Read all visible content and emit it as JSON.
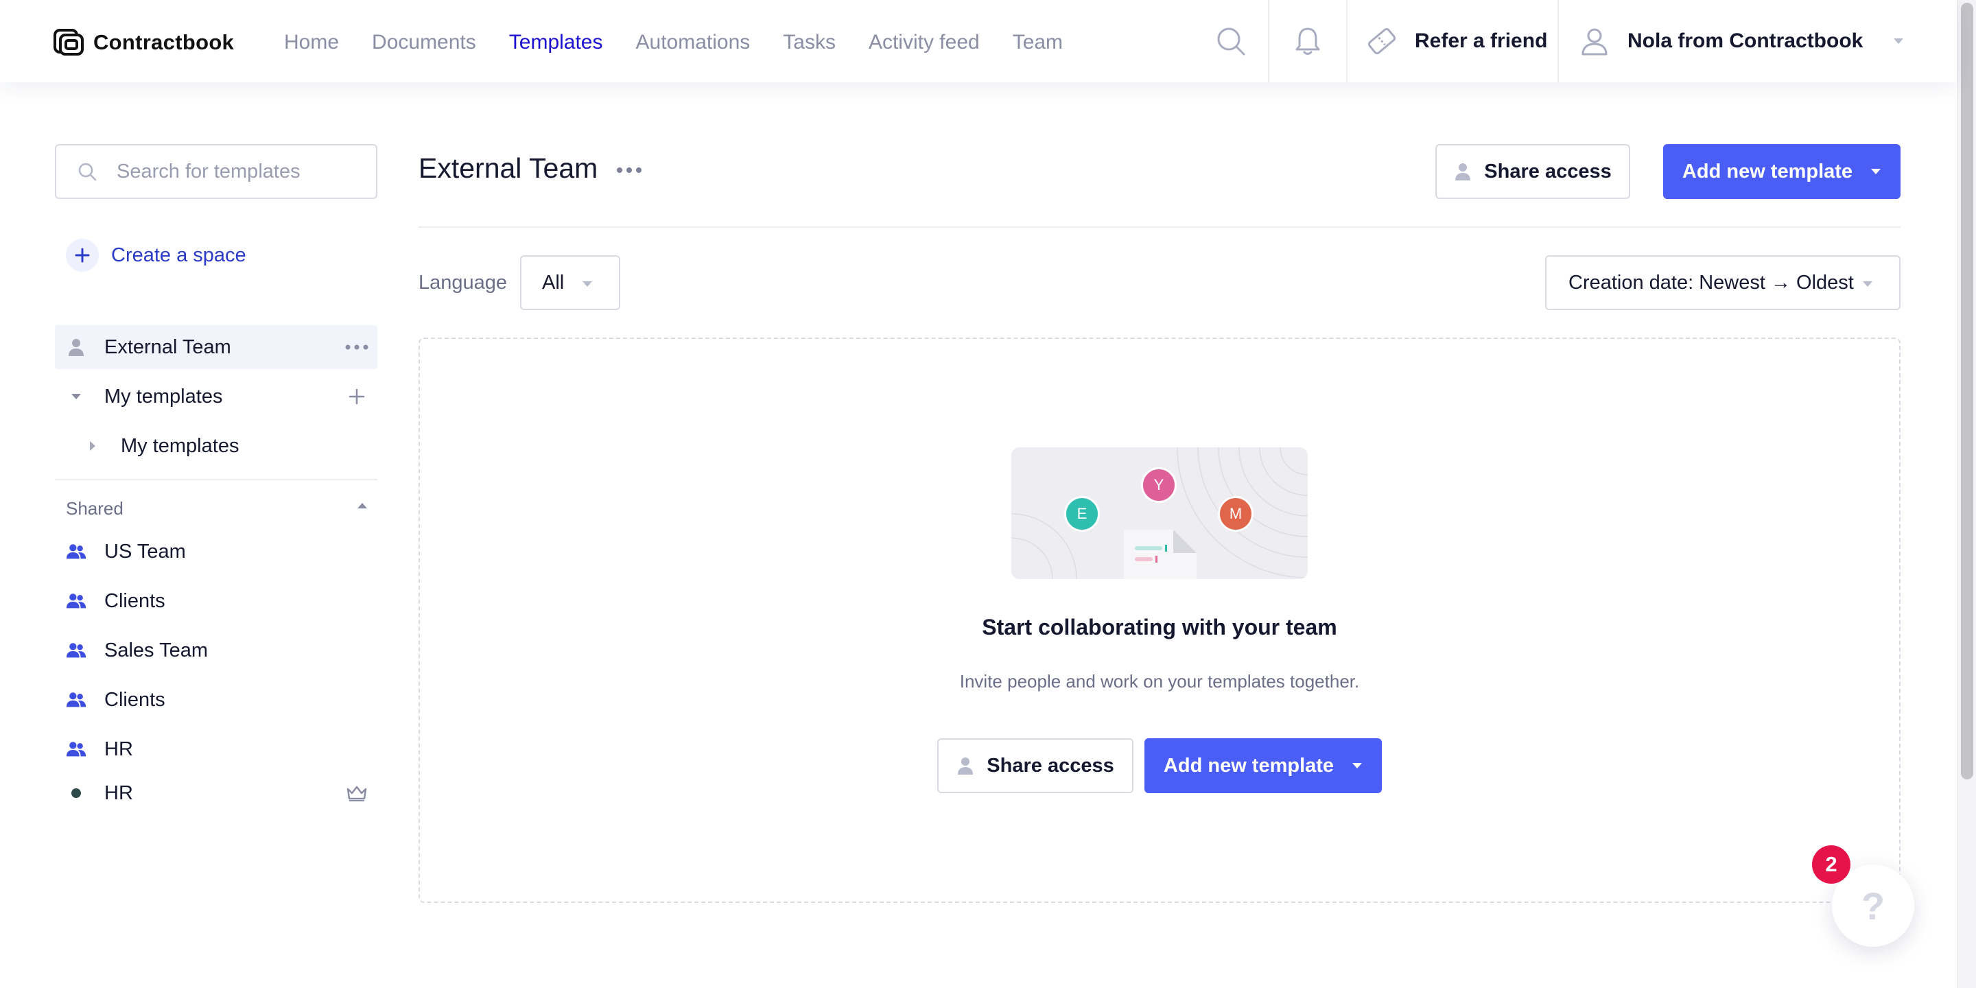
{
  "app": {
    "logo_text": "Contractbook",
    "colors": {
      "accent": "#4a5df5",
      "nav_active": "#1a0fd1",
      "badge": "#e5134a"
    }
  },
  "nav": {
    "items": [
      {
        "label": "Home",
        "active": false
      },
      {
        "label": "Documents",
        "active": false
      },
      {
        "label": "Templates",
        "active": true
      },
      {
        "label": "Automations",
        "active": false
      },
      {
        "label": "Tasks",
        "active": false
      },
      {
        "label": "Activity feed",
        "active": false
      },
      {
        "label": "Team",
        "active": false
      }
    ],
    "refer_label": "Refer a friend",
    "user_label": "Nola from Contractbook"
  },
  "sidebar": {
    "search_placeholder": "Search for templates",
    "create_space_label": "Create a space",
    "spaces": [
      {
        "label": "External Team",
        "icon": "person-icon",
        "selected": true
      },
      {
        "label": "My templates",
        "icon": "caret-down-icon"
      },
      {
        "label": "My templates",
        "icon": "caret-right-icon"
      }
    ],
    "shared_label": "Shared",
    "shared_items": [
      {
        "label": "US Team",
        "icon": "people-icon"
      },
      {
        "label": "Clients",
        "icon": "people-icon"
      },
      {
        "label": "Sales Team",
        "icon": "people-icon"
      },
      {
        "label": "Clients",
        "icon": "people-icon"
      },
      {
        "label": "HR",
        "icon": "people-icon"
      },
      {
        "label": "HR",
        "icon": "dot-icon",
        "owner_badge": "crown-icon"
      }
    ]
  },
  "main": {
    "title": "External Team",
    "share_access_label": "Share access",
    "add_template_label": "Add new template",
    "language_label": "Language",
    "language_value": "All",
    "sort_value": "Creation date: Newest → Oldest",
    "empty": {
      "avatars": [
        "E",
        "Y",
        "M"
      ],
      "title": "Start collaborating with your team",
      "subtitle": "Invite people and work on your templates together.",
      "share_access_label": "Share access",
      "add_template_label": "Add new template"
    }
  },
  "help": {
    "glyph": "?",
    "badge_count": "2"
  }
}
